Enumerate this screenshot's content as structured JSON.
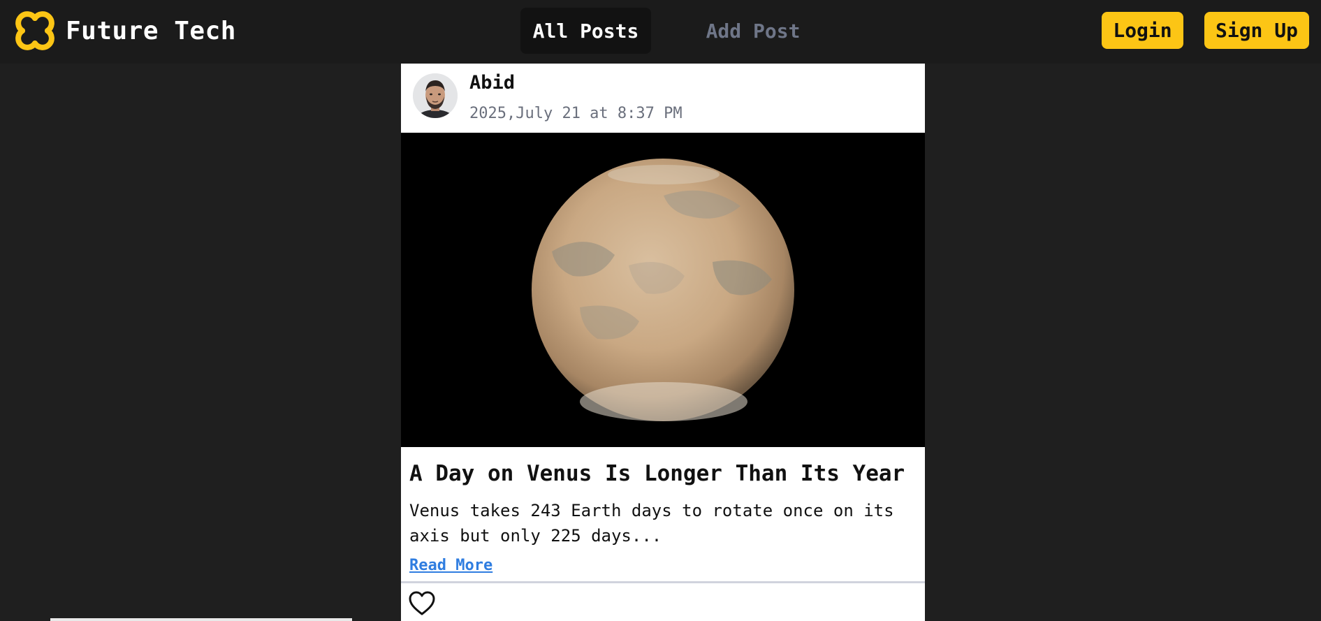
{
  "navbar": {
    "brand_name": "Future Tech",
    "brand_icon": "interlocked-rings-logo-icon",
    "accent_color": "#fcc515",
    "tabs": [
      {
        "label": "All Posts",
        "active": true
      },
      {
        "label": "Add Post",
        "active": false
      }
    ],
    "login_label": "Login",
    "signup_label": "Sign Up"
  },
  "post": {
    "author": "Abid",
    "date": "2025,July 21 at 8:37 PM",
    "image_subject": "planet-globe",
    "title": "A Day on Venus Is Longer Than Its Year",
    "excerpt": "Venus takes 243 Earth days to rotate once on its axis but only 225 days...",
    "read_more_label": "Read More",
    "like_icon": "heart-outline-icon",
    "link_color": "#2f7de0"
  }
}
